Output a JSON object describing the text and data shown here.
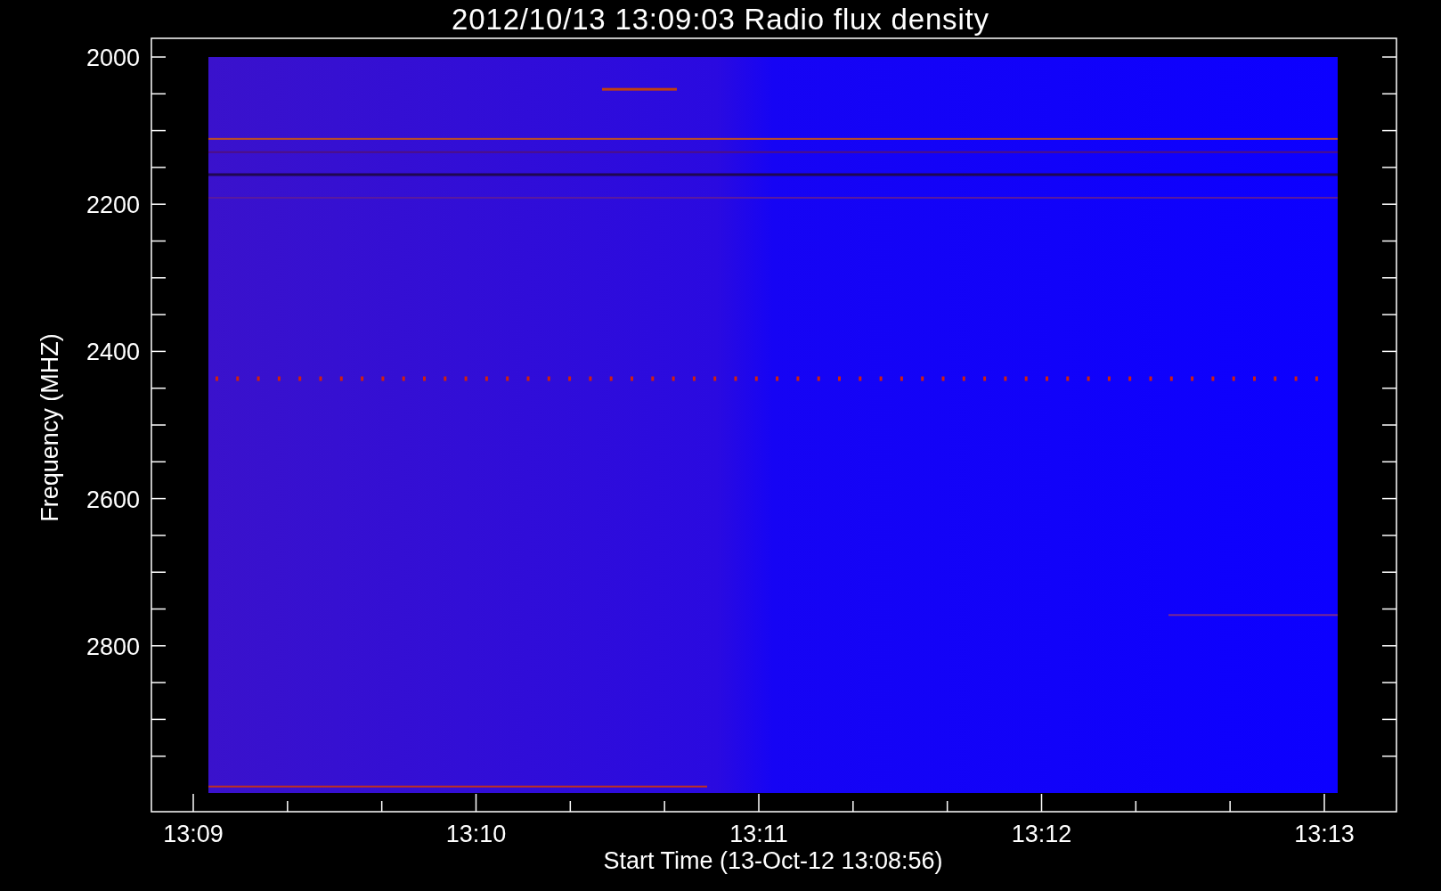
{
  "title": "2012/10/13 13:09:03 Radio flux density",
  "y_axis": {
    "label": "Frequency (MHZ)",
    "ticks": [
      "2000",
      "2200",
      "2400",
      "2600",
      "2800"
    ]
  },
  "x_axis": {
    "label": "Start Time (13-Oct-12 13:08:56)",
    "ticks": [
      "13:09",
      "13:10",
      "13:11",
      "13:12",
      "13:13"
    ]
  }
}
